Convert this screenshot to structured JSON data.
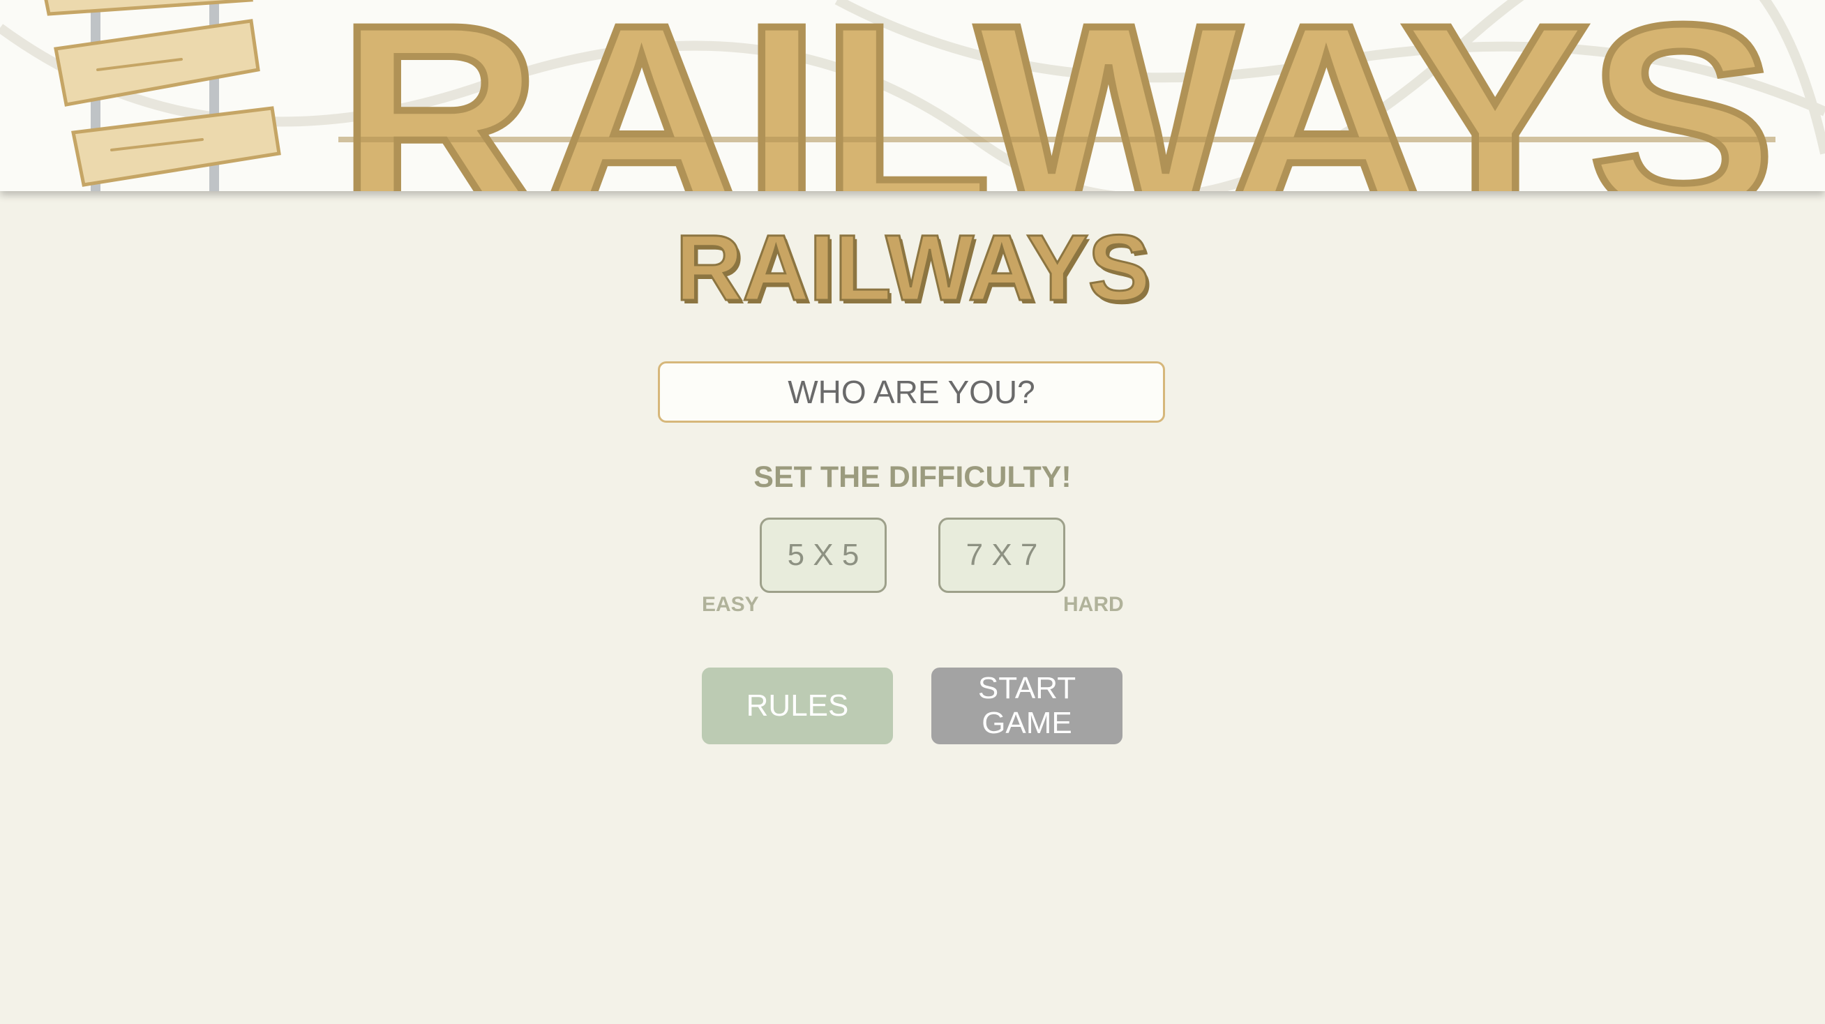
{
  "banner": {
    "logo_text": "RAILWAYS"
  },
  "title": "RAILWAYS",
  "name_input": {
    "placeholder": "WHO ARE YOU?",
    "value": ""
  },
  "difficulty": {
    "heading": "SET THE DIFFICULTY!",
    "options": [
      "5 X 5",
      "7 X 7"
    ],
    "easy_label": "EASY",
    "hard_label": "HARD"
  },
  "actions": {
    "rules_label": "RULES",
    "start_label": "START\nGAME"
  },
  "colors": {
    "background": "#f3f2e8",
    "title_gold": "#c9a563",
    "title_outline": "#8c7541",
    "rules_button": "#bccbb3",
    "start_button": "#a3a3a3",
    "difficulty_button": "#e8ecdc"
  }
}
